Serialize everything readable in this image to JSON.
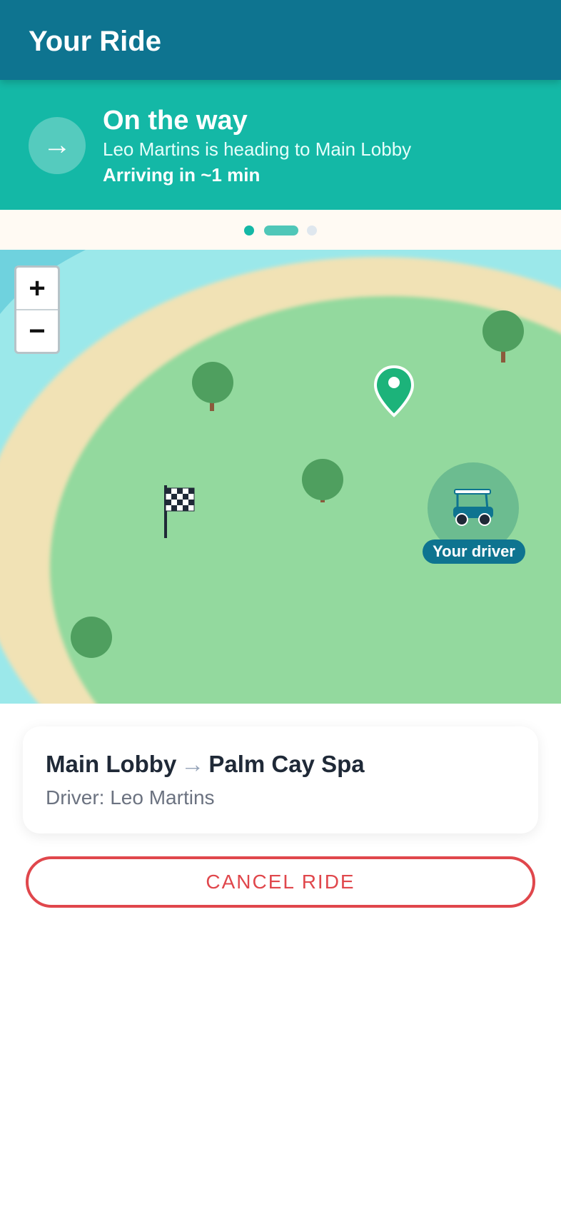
{
  "header": {
    "title": "Your Ride"
  },
  "status": {
    "icon": "arrow-right-icon",
    "title": "On the way",
    "subtitle": "Leo Martins is heading to Main Lobby",
    "eta": "Arriving in ~1 min"
  },
  "pager": {
    "steps": 3,
    "active_step": 2
  },
  "map": {
    "zoom_in_label": "+",
    "zoom_out_label": "−",
    "driver_label": "Your driver",
    "icons": [
      "pickup-pin-icon",
      "finish-flag-icon",
      "golf-cart-icon",
      "tree-icon"
    ]
  },
  "trip": {
    "from": "Main Lobby",
    "arrow": "→",
    "to": "Palm Cay Spa",
    "driver_text": "Driver: Leo Martins"
  },
  "actions": {
    "cancel_label": "CANCEL RIDE"
  },
  "colors": {
    "header": "#0e7490",
    "status": "#14b8a6",
    "grass": "#93d99e",
    "sand": "#f1e2b5",
    "water": "#9be8ea",
    "danger": "#e0474c"
  }
}
